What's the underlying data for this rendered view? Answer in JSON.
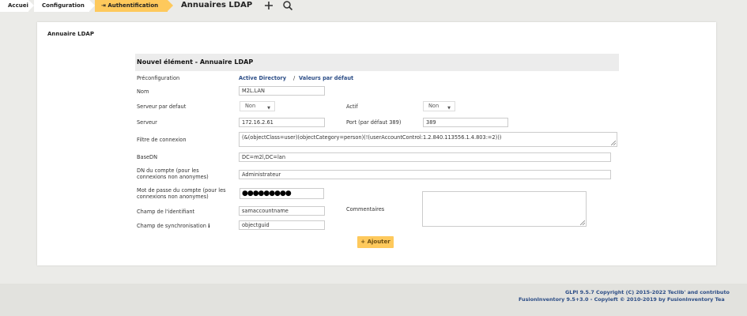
{
  "breadcrumb": {
    "home": "Accueil",
    "config": "Configuration",
    "auth": "Authentification"
  },
  "page_title": "Annuaires LDAP",
  "panel": {
    "tab_label": "Annuaire LDAP"
  },
  "form": {
    "header": "Nouvel élément - Annuaire LDAP",
    "preconfig_label": "Préconfiguration",
    "preconfig_ad": "Active Directory",
    "preconfig_sep": "/",
    "preconfig_default": "Valeurs par défaut",
    "name_label": "Nom",
    "name_value": "M2L.LAN",
    "default_server_label": "Serveur par defaut",
    "default_server_value": "Non",
    "active_label": "Actif",
    "active_value": "Non",
    "server_label": "Serveur",
    "server_value": "172.16.2.61",
    "port_label": "Port (par défaut 389)",
    "port_value": "389",
    "filter_label": "Filtre de connexion",
    "filter_value": "(&(objectClass=user)(objectCategory=person)(!(userAccountControl:1.2.840.113556.1.4.803:=2)))",
    "basedn_label": "BaseDN",
    "basedn_value": "DC=m2l,DC=lan",
    "account_dn_label": "DN du compte (pour les connexions non anonymes)",
    "account_dn_value": "Administrateur",
    "password_label": "Mot de passe du compte (pour les connexions non anonymes)",
    "password_value": "●●●●●●●●●",
    "identifier_label": "Champ de l'identifiant",
    "identifier_value": "samaccountname",
    "comments_label": "Commentaires",
    "sync_label": "Champ de synchronisation",
    "sync_info_icon": "ℹ",
    "sync_value": "objectguid",
    "add_button": "+ Ajouter"
  },
  "footer": {
    "line1": "GLPI 9.5.7 Copyright (C) 2015-2022 Teclib' and contributo",
    "line2": "FusionInventory 9.5+3.0 - Copyleft © 2010-2019 by FusionInventory Tea"
  },
  "colors": {
    "accent": "#fec95c",
    "link": "#2c4d86"
  }
}
